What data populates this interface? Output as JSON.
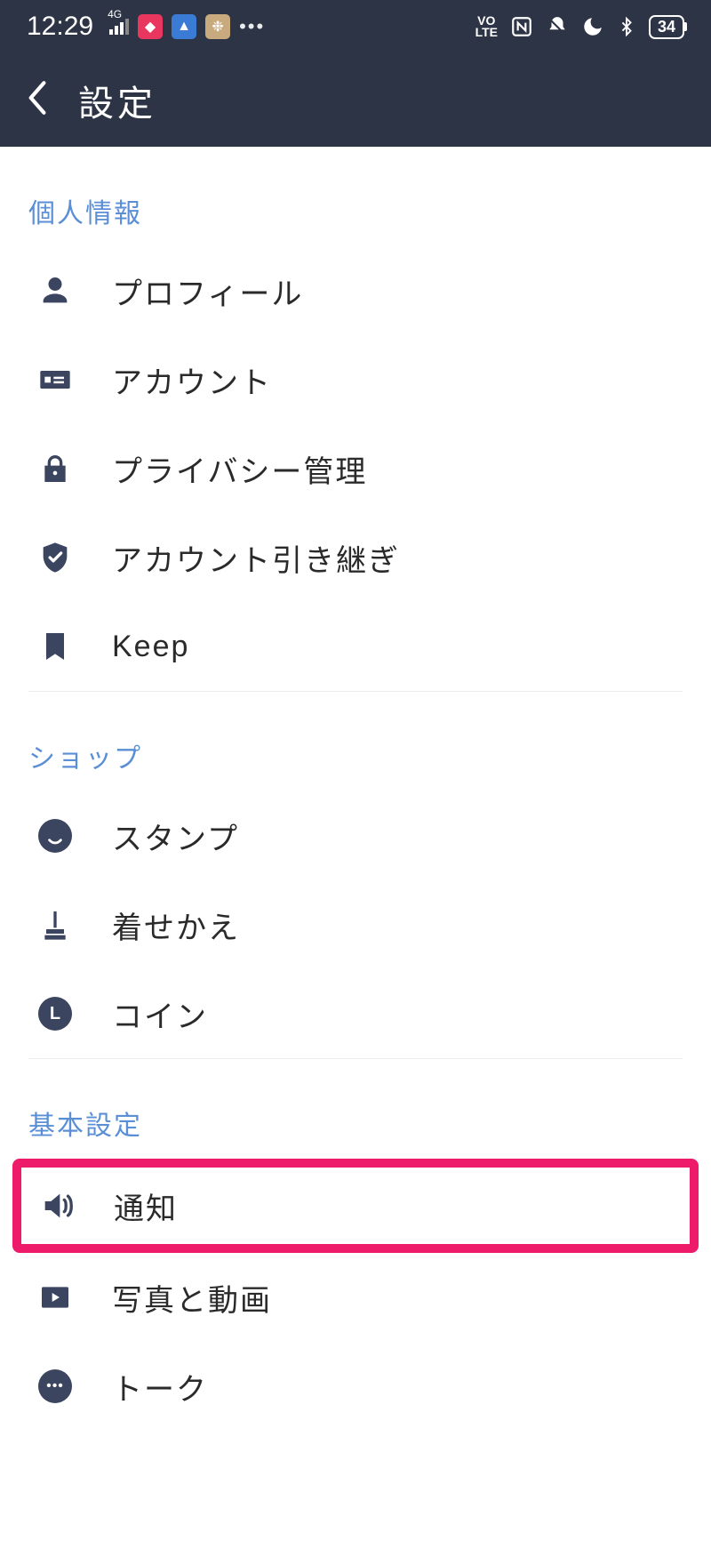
{
  "status": {
    "time": "12:29",
    "network_label": "4G",
    "volte": "VO LTE",
    "battery": "34"
  },
  "header": {
    "title": "設定"
  },
  "sections": {
    "personal": {
      "title": "個人情報"
    },
    "shop": {
      "title": "ショップ"
    },
    "basic": {
      "title": "基本設定"
    }
  },
  "items": {
    "profile": "プロフィール",
    "account": "アカウント",
    "privacy": "プライバシー管理",
    "transfer": "アカウント引き継ぎ",
    "keep": "Keep",
    "stamps": "スタンプ",
    "themes": "着せかえ",
    "coins": "コイン",
    "coin_letter": "L",
    "notifications": "通知",
    "photos": "写真と動画",
    "talk": "トーク"
  }
}
